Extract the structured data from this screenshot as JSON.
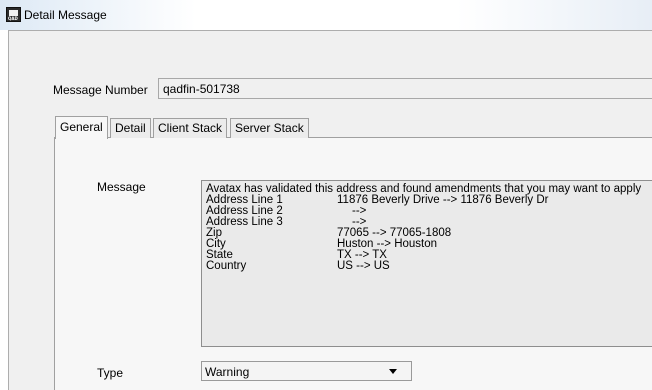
{
  "window": {
    "title": "Detail Message",
    "icon": "qad-app-icon",
    "icon_text": "QAD"
  },
  "form": {
    "message_number_label": "Message Number",
    "message_number_value": "qadfin-501738",
    "type_label": "Type",
    "type_value": "Warning"
  },
  "tabs": [
    {
      "label": "General",
      "active": true
    },
    {
      "label": "Detail",
      "active": false
    },
    {
      "label": "Client Stack",
      "active": false
    },
    {
      "label": "Server Stack",
      "active": false
    }
  ],
  "general": {
    "message_label": "Message",
    "message_header": "Avatax has validated this address and found amendments that you may want to apply",
    "rows": [
      {
        "field": "Address Line 1",
        "change": "11876 Beverly Drive --> 11876 Beverly Dr"
      },
      {
        "field": "Address Line 2",
        "change": "-->"
      },
      {
        "field": "Address Line 3",
        "change": "-->"
      },
      {
        "field": "Zip",
        "change": "77065 --> 77065-1808"
      },
      {
        "field": "City",
        "change": "Huston --> Houston"
      },
      {
        "field": "State",
        "change": "TX --> TX"
      },
      {
        "field": "Country",
        "change": "US --> US"
      }
    ]
  }
}
